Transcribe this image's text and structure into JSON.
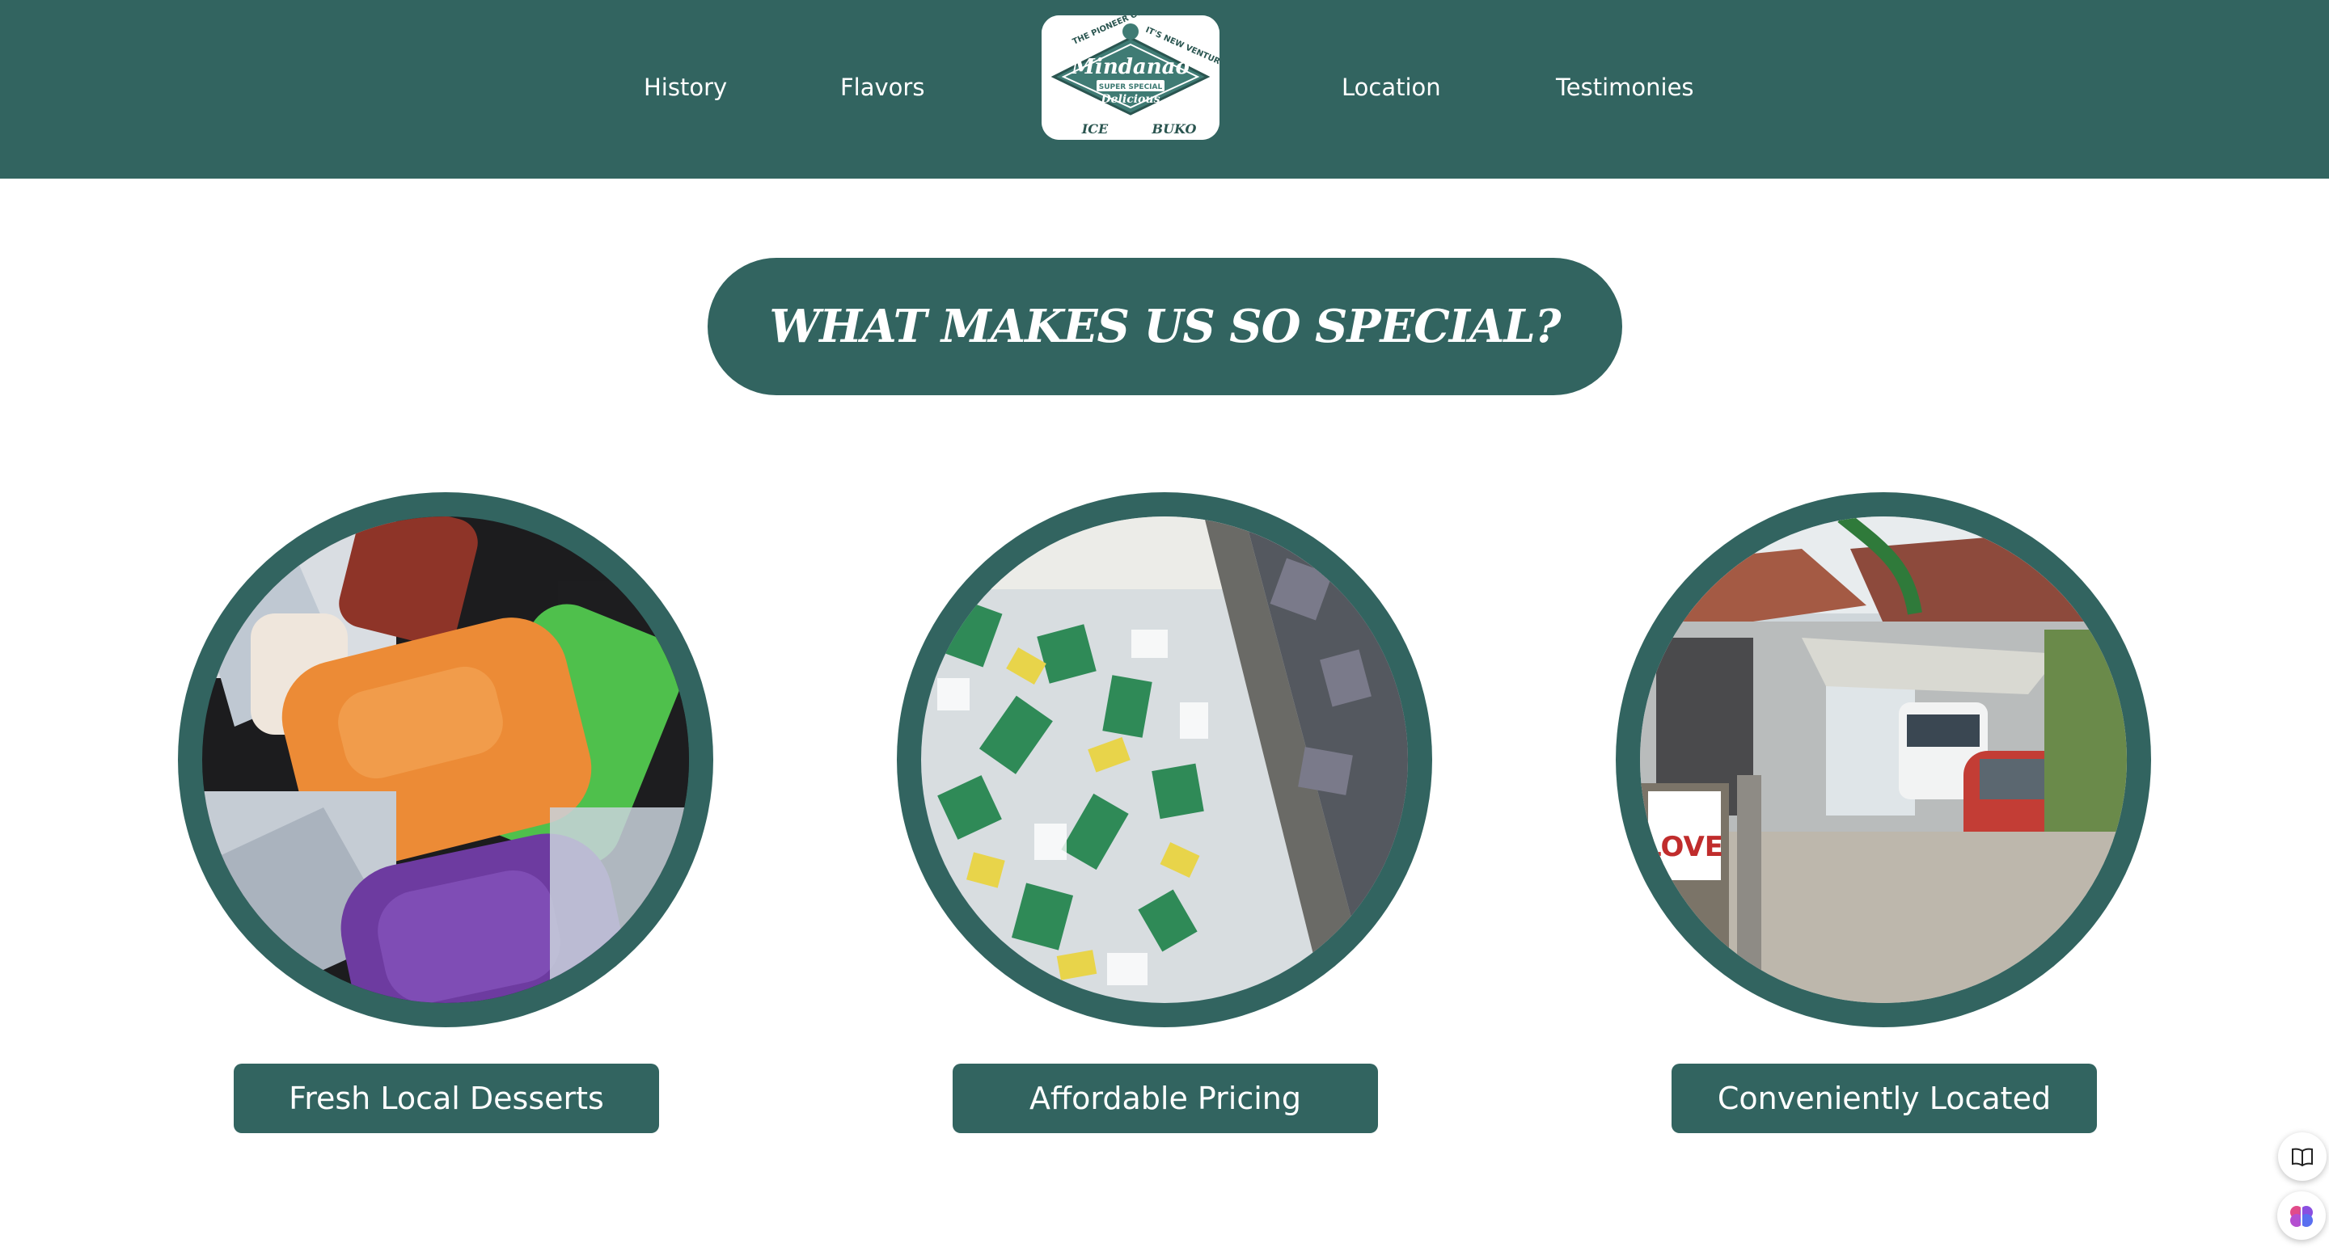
{
  "nav": {
    "links": [
      "History",
      "Flavors",
      "Location",
      "Testimonies"
    ]
  },
  "logo": {
    "top_arc": "THE PIONEER ON · IT'S NEW VENTURE",
    "brand": "Mindanao",
    "tag": "SUPER SPECIAL",
    "sub": "Delicious",
    "left_word": "ICE",
    "right_word": "BUKO"
  },
  "section": {
    "heading": "WHAT MAKES US SO SPECIAL?"
  },
  "features": [
    {
      "label": "Fresh Local Desserts",
      "image": "ice-candy-photo"
    },
    {
      "label": "Affordable Pricing",
      "image": "packed-ice-photo"
    },
    {
      "label": "Conveniently Located",
      "image": "storefront-photo"
    }
  ],
  "side_buttons": [
    {
      "icon": "book-icon"
    },
    {
      "icon": "brain-icon"
    }
  ],
  "colors": {
    "brand_green": "#326460",
    "white": "#ffffff"
  }
}
